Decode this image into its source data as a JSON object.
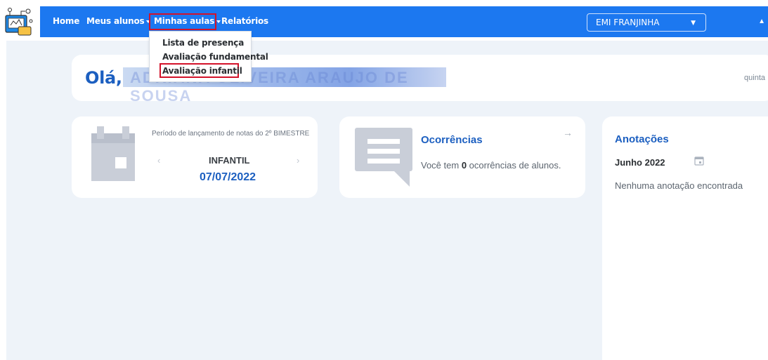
{
  "nav": {
    "items": [
      {
        "label": "Home"
      },
      {
        "label": "Meus alunos"
      },
      {
        "label": "Minhas aulas"
      },
      {
        "label": "Relatórios"
      }
    ],
    "school_select": "EMI FRANJINHA"
  },
  "menu": {
    "items": [
      {
        "label": "Lista de presença"
      },
      {
        "label": "Avaliação fundamental"
      },
      {
        "label": "Avaliação infantil"
      }
    ]
  },
  "greeting": {
    "prefix": "Olá,",
    "name": "ADRIANA OLIVEIRA ARAUJO DE SOUSA",
    "date_partial": "quinta"
  },
  "period_card": {
    "text": "Período de lançamento de notas do 2º BIMESTRE",
    "segment": "INFANTIL",
    "date": "07/07/2022"
  },
  "ocorrencias_card": {
    "title": "Ocorrências",
    "text_before": "Você tem ",
    "count": "0",
    "text_after": " ocorrências de alunos."
  },
  "anotacoes_card": {
    "title": "Anotações",
    "month": "Junho 2022",
    "empty": "Nenhuma anotação encontrada"
  },
  "colors": {
    "nav_bg": "#1c78f0",
    "accent": "#1c5fc0",
    "highlight": "#d3122a",
    "page_bg": "#eef3f9"
  }
}
